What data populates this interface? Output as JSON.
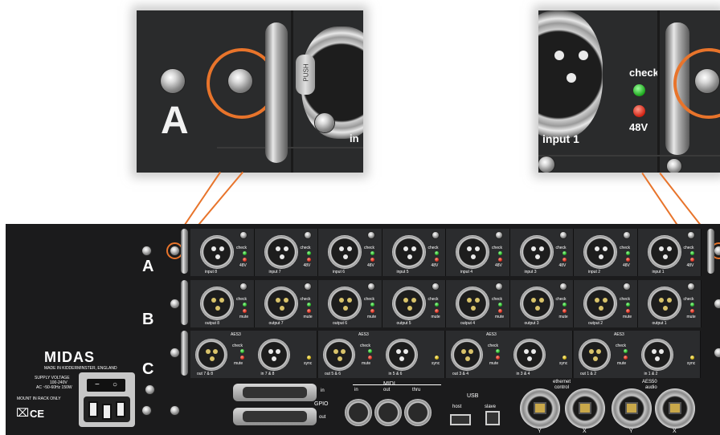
{
  "brand": "MIDAS",
  "made_in": "MADE IN KIDDERMINSTER, ENGLAND",
  "supply": {
    "line1": "SUPPLY VOLTAGE",
    "line2": "100-240V",
    "line3": "AC ~50-60Hz 150W"
  },
  "mount_note": "MOUNT IN RACK ONLY",
  "ce_mark": "CE",
  "zoom_left": {
    "letter": "A",
    "push": "PUSH",
    "partial_label": "in"
  },
  "zoom_right": {
    "check": "check",
    "phantom": "48V",
    "input_label": "input 1"
  },
  "rows": [
    {
      "letter": "A",
      "type": "input",
      "cards": [
        {
          "label": "input 8",
          "led1": "check",
          "led2": "48V"
        },
        {
          "label": "input 7",
          "led1": "check",
          "led2": "48V"
        },
        {
          "label": "input 6",
          "led1": "check",
          "led2": "48V"
        },
        {
          "label": "input 5",
          "led1": "check",
          "led2": "48V"
        },
        {
          "label": "input 4",
          "led1": "check",
          "led2": "48V"
        },
        {
          "label": "input 3",
          "led1": "check",
          "led2": "48V"
        },
        {
          "label": "input 2",
          "led1": "check",
          "led2": "48V"
        },
        {
          "label": "input 1",
          "led1": "check",
          "led2": "48V"
        }
      ]
    },
    {
      "letter": "B",
      "type": "output",
      "cards": [
        {
          "label": "output 8",
          "led1": "check",
          "led2": "mute"
        },
        {
          "label": "output 7",
          "led1": "check",
          "led2": "mute"
        },
        {
          "label": "output 6",
          "led1": "check",
          "led2": "mute"
        },
        {
          "label": "output 5",
          "led1": "check",
          "led2": "mute"
        },
        {
          "label": "output 4",
          "led1": "check",
          "led2": "mute"
        },
        {
          "label": "output 3",
          "led1": "check",
          "led2": "mute"
        },
        {
          "label": "output 2",
          "led1": "check",
          "led2": "mute"
        },
        {
          "label": "output 1",
          "led1": "check",
          "led2": "mute"
        }
      ]
    },
    {
      "letter": "C",
      "type": "aes3",
      "cards": [
        {
          "label": "out 7 & 8",
          "tag": "AES3",
          "led1": "check",
          "led2": "mute",
          "second_label": "in 7 & 8",
          "led3": "sync"
        },
        {
          "label": "out 5 & 6",
          "tag": "AES3",
          "led1": "check",
          "led2": "mute",
          "second_label": "in 5 & 6",
          "led3": "sync"
        },
        {
          "label": "out 3 & 4",
          "tag": "AES3",
          "led1": "check",
          "led2": "mute",
          "second_label": "in 3 & 4",
          "led3": "sync"
        },
        {
          "label": "out 1 & 2",
          "tag": "AES3",
          "led1": "check",
          "led2": "mute",
          "second_label": "in 1 & 2",
          "led3": "sync"
        }
      ]
    }
  ],
  "gpio": {
    "label": "GPIO",
    "in": "in",
    "out": "out"
  },
  "midi": {
    "label": "MIDI",
    "in": "in",
    "out": "out",
    "thru": "thru"
  },
  "usb": {
    "label": "USB",
    "host": "host",
    "slave": "slave"
  },
  "ethernet": {
    "control_top": "ethernet",
    "control_bottom": "control",
    "audio_top": "AES50",
    "audio_bottom": "audio",
    "ports": [
      "Y",
      "X",
      "Y",
      "X"
    ]
  },
  "colors": {
    "accent_ring": "#e8742b",
    "panel": "#2b2c2e",
    "led_green": "#1aa51a",
    "led_red": "#d02010"
  }
}
